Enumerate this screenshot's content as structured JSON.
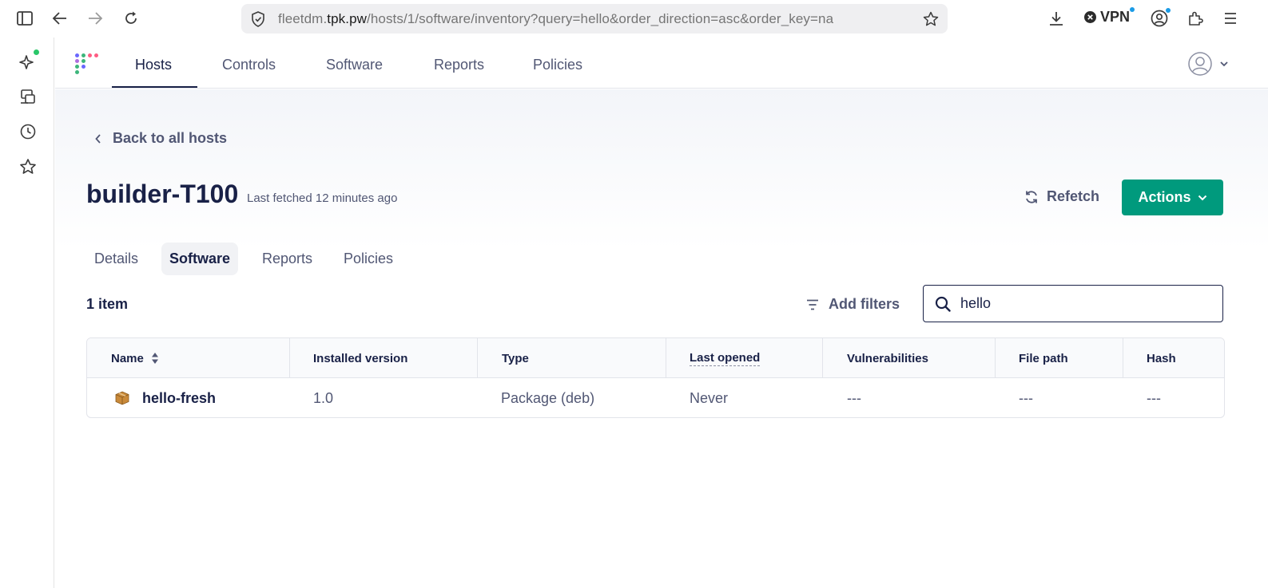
{
  "browser": {
    "url_domain_prefix": "fleetdm.",
    "url_domain": "tpk.pw",
    "url_path": "/hosts/1/software/inventory?query=hello&order_direction=asc&order_key=na",
    "vpn_label": "VPN",
    "icons": [
      "sidebar-toggle-icon",
      "back-icon",
      "forward-icon",
      "reload-icon",
      "shield-icon",
      "bookmark-star-icon",
      "download-icon",
      "vpn-close-icon",
      "account-icon",
      "extensions-icon",
      "menu-icon"
    ]
  },
  "ff_sidebar": {
    "icons": [
      "sparkle-ai-icon",
      "synced-tabs-icon",
      "history-icon",
      "bookmarks-icon"
    ]
  },
  "app": {
    "nav": [
      {
        "label": "Hosts",
        "active": true
      },
      {
        "label": "Controls"
      },
      {
        "label": "Software"
      },
      {
        "label": "Reports"
      },
      {
        "label": "Policies"
      }
    ],
    "brand_color": "#009a7d"
  },
  "host": {
    "back_label": "Back to all hosts",
    "name": "builder-T100",
    "last_fetched": "Last fetched 12 minutes ago",
    "refetch_label": "Refetch",
    "actions_label": "Actions"
  },
  "host_tabs": [
    {
      "label": "Details"
    },
    {
      "label": "Software",
      "active": true
    },
    {
      "label": "Reports"
    },
    {
      "label": "Policies"
    }
  ],
  "software": {
    "item_count": "1 item",
    "add_filters_label": "Add filters",
    "search_value": "hello",
    "columns": [
      "Name",
      "Installed version",
      "Type",
      "Last opened",
      "Vulnerabilities",
      "File path",
      "Hash"
    ],
    "rows": [
      {
        "name": "hello-fresh",
        "installed_version": "1.0",
        "type": "Package (deb)",
        "last_opened": "Never",
        "vulnerabilities": "---",
        "file_path": "---",
        "hash": "---"
      }
    ]
  }
}
